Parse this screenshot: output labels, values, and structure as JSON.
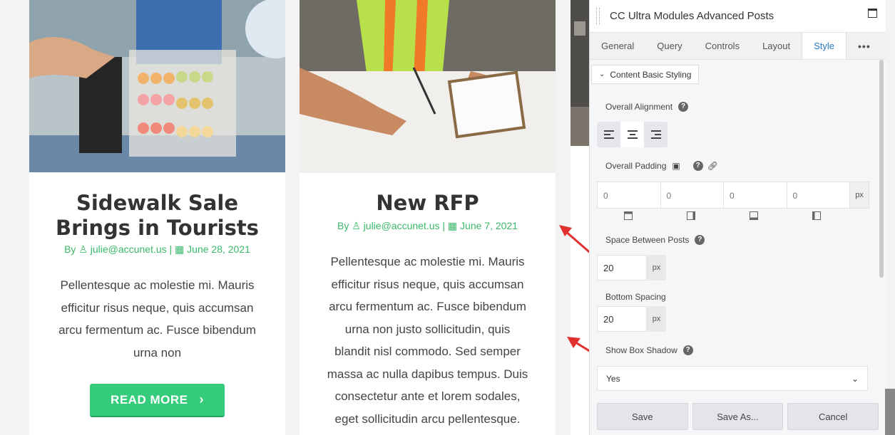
{
  "posts": [
    {
      "title_line1": "Sidewalk Sale",
      "title_line2": "Brings in Tourists",
      "meta_by": "By",
      "author": "julie@accunet.us",
      "date": "June 28, 2021",
      "excerpt": [
        "Pellentesque ac molestie mi. Mauris",
        "efficitur risus neque, quis accumsan",
        "arcu fermentum ac. Fusce bibendum",
        "urna non"
      ],
      "read_more": "READ MORE"
    },
    {
      "title_line1": "New RFP",
      "meta_by": "By",
      "author": "julie@accunet.us",
      "date": "June 7, 2021",
      "excerpt": [
        "Pellentesque ac molestie mi. Mauris",
        "efficitur risus neque, quis accumsan",
        "arcu fermentum ac. Fusce bibendum",
        "urna non justo sollicitudin, quis",
        "blandit nisl commodo. Sed semper",
        "massa ac nulla dapibus tempus. Duis",
        "consectetur ante et lorem sodales,",
        "eget sollicitudin arcu pellentesque."
      ]
    }
  ],
  "panel": {
    "title": "CC Ultra Modules Advanced Posts",
    "tabs": [
      "General",
      "Query",
      "Controls",
      "Layout",
      "Style",
      "•••"
    ],
    "active_tab": "Style",
    "section": "Content Basic Styling",
    "overall_alignment": "Overall Alignment",
    "overall_padding": "Overall Padding",
    "padding_values": [
      "0",
      "0",
      "0",
      "0"
    ],
    "padding_unit": "px",
    "space_between": "Space Between Posts",
    "space_between_value": "20",
    "bottom_spacing": "Bottom Spacing",
    "bottom_spacing_value": "20",
    "unit": "px",
    "box_shadow_label": "Show Box Shadow",
    "box_shadow_value": "Yes",
    "buttons": {
      "save": "Save",
      "save_as": "Save As...",
      "cancel": "Cancel"
    }
  },
  "colors": {
    "accent_green": "#34cc7b",
    "meta_green": "#3ab86a",
    "tab_blue": "#2b78c5",
    "arrow_red": "#e03030"
  }
}
